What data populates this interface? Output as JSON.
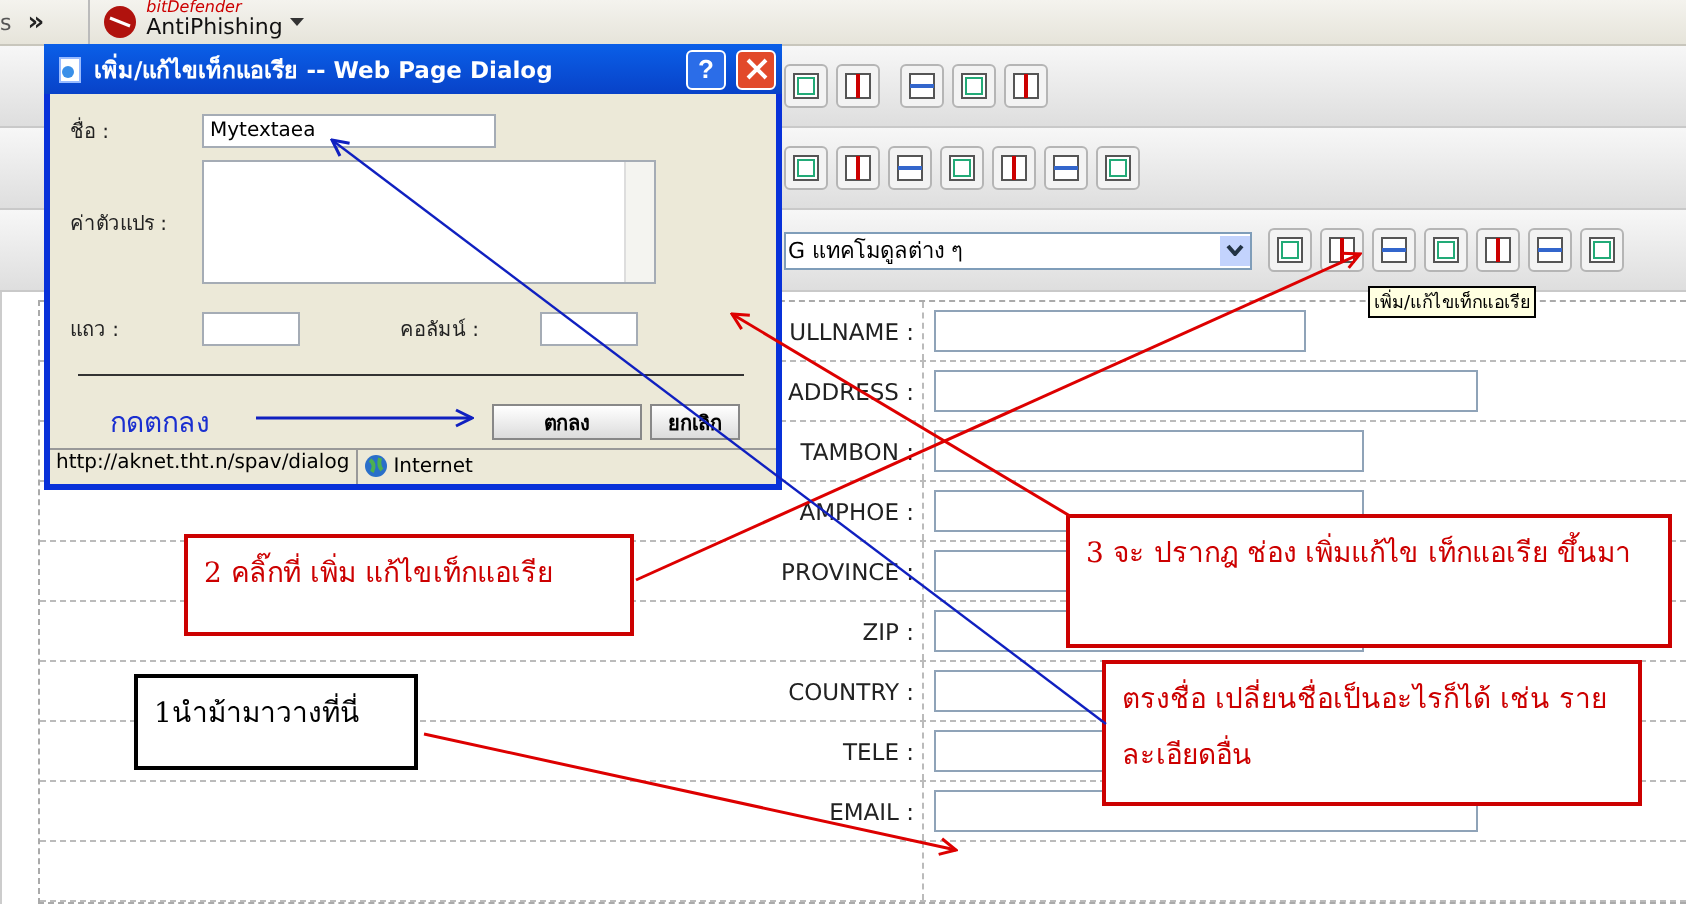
{
  "browser_toolbar": {
    "fragment": "s",
    "overflow": "»",
    "addon": {
      "brand": "bitDefender",
      "name": "AntiPhishing"
    }
  },
  "editor": {
    "module_select": {
      "value": "G แทคโมดูลต่าง ๆ"
    },
    "tooltip": "เพิ่ม/แก้ไขเท็กแอเรีย"
  },
  "form": {
    "rows": [
      {
        "label": "ULLNAME :"
      },
      {
        "label": "ADDRESS :"
      },
      {
        "label": "TAMBON :"
      },
      {
        "label": "AMPHOE :"
      },
      {
        "label": "PROVINCE :"
      },
      {
        "label": "ZIP :"
      },
      {
        "label": "COUNTRY :"
      },
      {
        "label": "TELE :"
      },
      {
        "label": "EMAIL :"
      }
    ]
  },
  "dialog": {
    "title": "เพิ่ม/แก้ไขเท็กแอเรีย -- Web Page Dialog",
    "help": "?",
    "name": {
      "label": "ชื่อ :",
      "value": "Mytextaea"
    },
    "value": {
      "label": "ค่าตัวแปร :"
    },
    "rows": {
      "label": "แถว :"
    },
    "columns": {
      "label": "คอลัมน์ :"
    },
    "buttons": [
      "ตกลง",
      "ยกเลิก"
    ],
    "status": {
      "url": "http://aknet.tht.n/spav/dialog",
      "zone": "Internet"
    }
  },
  "annotations": {
    "press_ok": "กดตกลง",
    "callouts": [
      {
        "text": "2 คลิ๊กที่ เพิ่ม แก้ไขเท็กแอเรีย",
        "color": "#cc0000"
      },
      {
        "text": "1นำม้ามาวางที่นี่",
        "color": "#000000"
      },
      {
        "text": "3 จะ ปรากฎ ช่อง  เพิ่มแก้ไข เท็กแอเรีย ขึ้นมา",
        "color": "#cc0000"
      },
      {
        "text": "ตรงชื่อ เปลี่ยนชื่อเป็นอะไรก็ได้ เช่น รายละเอียดอื่น",
        "color": "#cc0000"
      }
    ]
  }
}
